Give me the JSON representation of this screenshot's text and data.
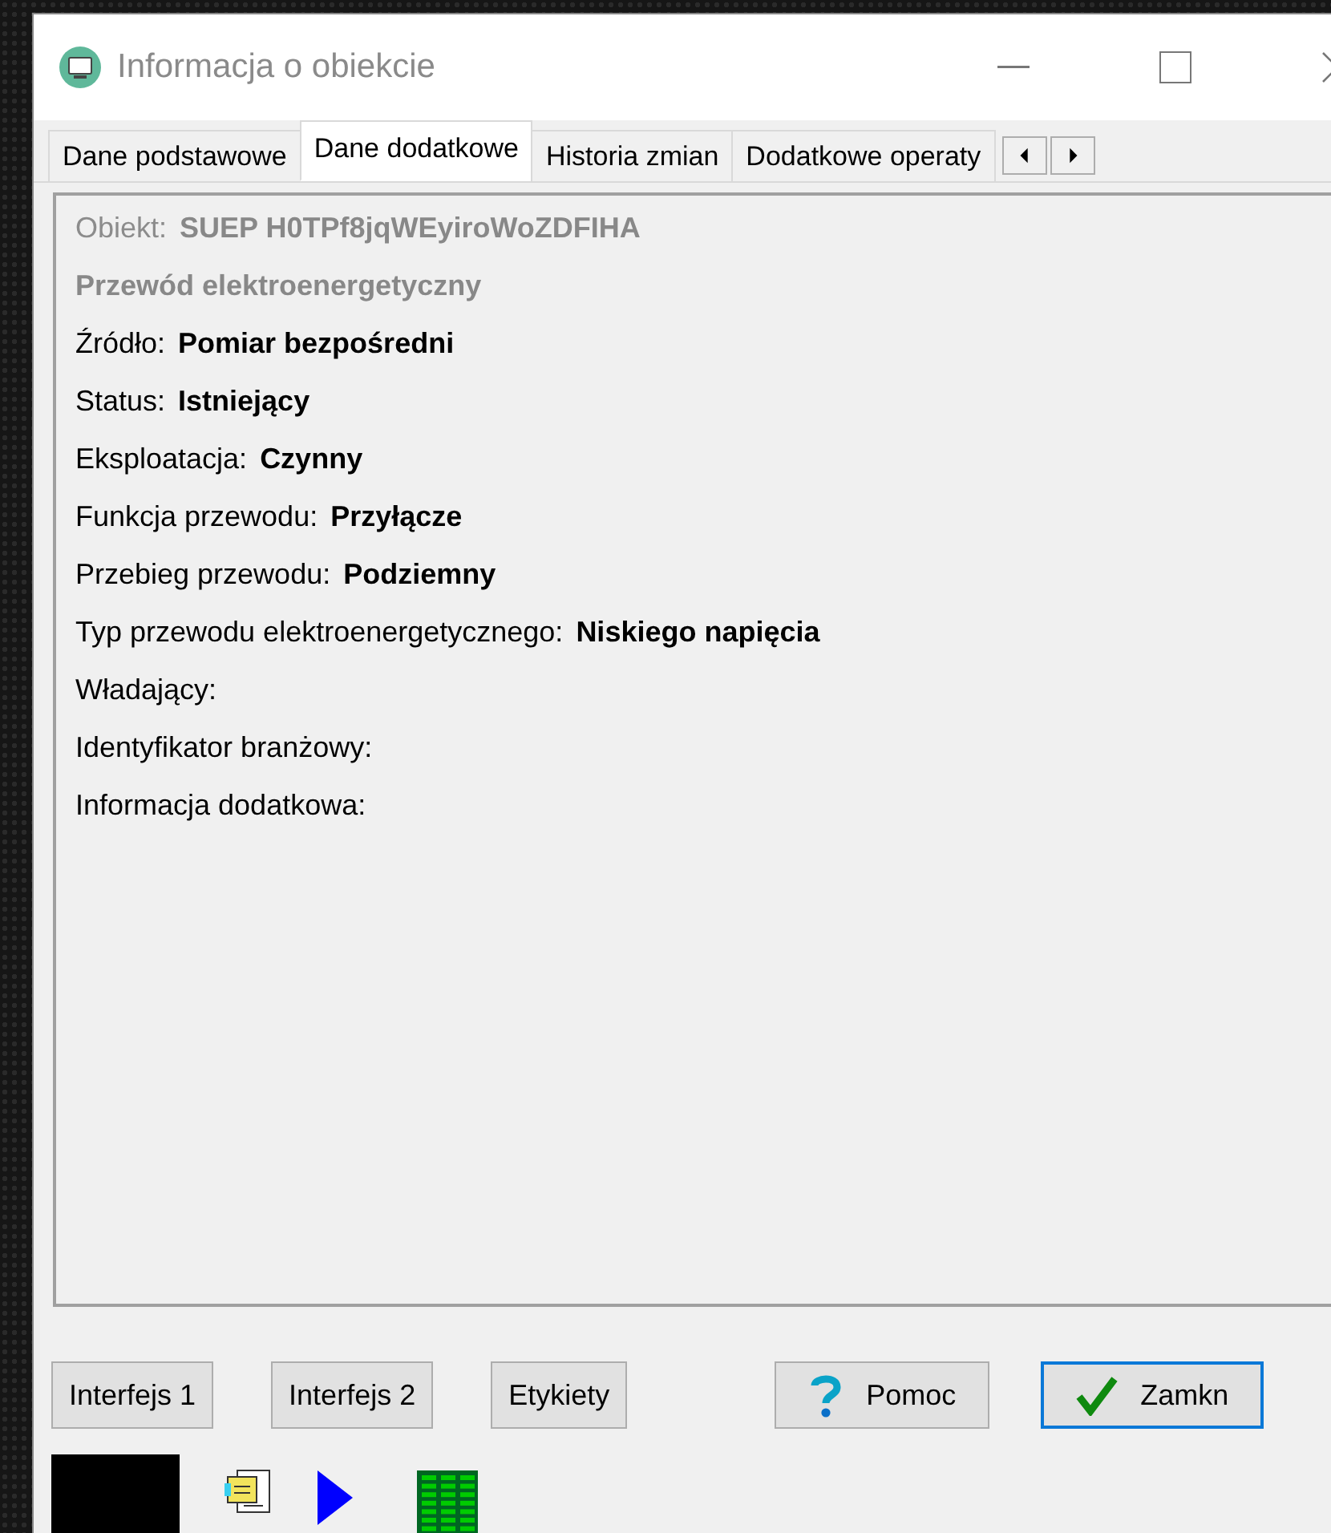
{
  "window": {
    "title": "Informacja o obiekcie"
  },
  "tabs": [
    {
      "label": "Dane podstawowe",
      "selected": false
    },
    {
      "label": "Dane dodatkowe",
      "selected": true
    },
    {
      "label": "Historia zmian",
      "selected": false
    },
    {
      "label": "Dodatkowe operaty",
      "selected": false
    }
  ],
  "details": [
    {
      "kind": "object",
      "label": "Obiekt:",
      "value": "SUEP H0TPf8jqWEyiroWoZDFIHA"
    },
    {
      "kind": "type",
      "value": "Przewód elektroenergetyczny"
    },
    {
      "kind": "field",
      "label": "Źródło:",
      "value": "Pomiar bezpośredni"
    },
    {
      "kind": "field",
      "label": "Status:",
      "value": "Istniejący"
    },
    {
      "kind": "field",
      "label": "Eksploatacja:",
      "value": "Czynny"
    },
    {
      "kind": "field",
      "label": "Funkcja przewodu:",
      "value": "Przyłącze"
    },
    {
      "kind": "field",
      "label": "Przebieg przewodu:",
      "value": "Podziemny"
    },
    {
      "kind": "field",
      "label": "Typ przewodu elektroenergetycznego:",
      "value": "Niskiego napięcia"
    },
    {
      "kind": "field",
      "label": "Władający:"
    },
    {
      "kind": "field",
      "label": "Identyfikator branżowy:"
    },
    {
      "kind": "field",
      "label": "Informacja dodatkowa:"
    }
  ],
  "buttons": [
    {
      "kind": "plain",
      "label": "Interfejs 1"
    },
    {
      "kind": "plain",
      "label": "Interfejs 2"
    },
    {
      "kind": "plain",
      "label": "Etykiety"
    },
    {
      "kind": "help",
      "label": "Pomoc"
    },
    {
      "kind": "close",
      "label": "Zamkn",
      "focused": true
    }
  ]
}
